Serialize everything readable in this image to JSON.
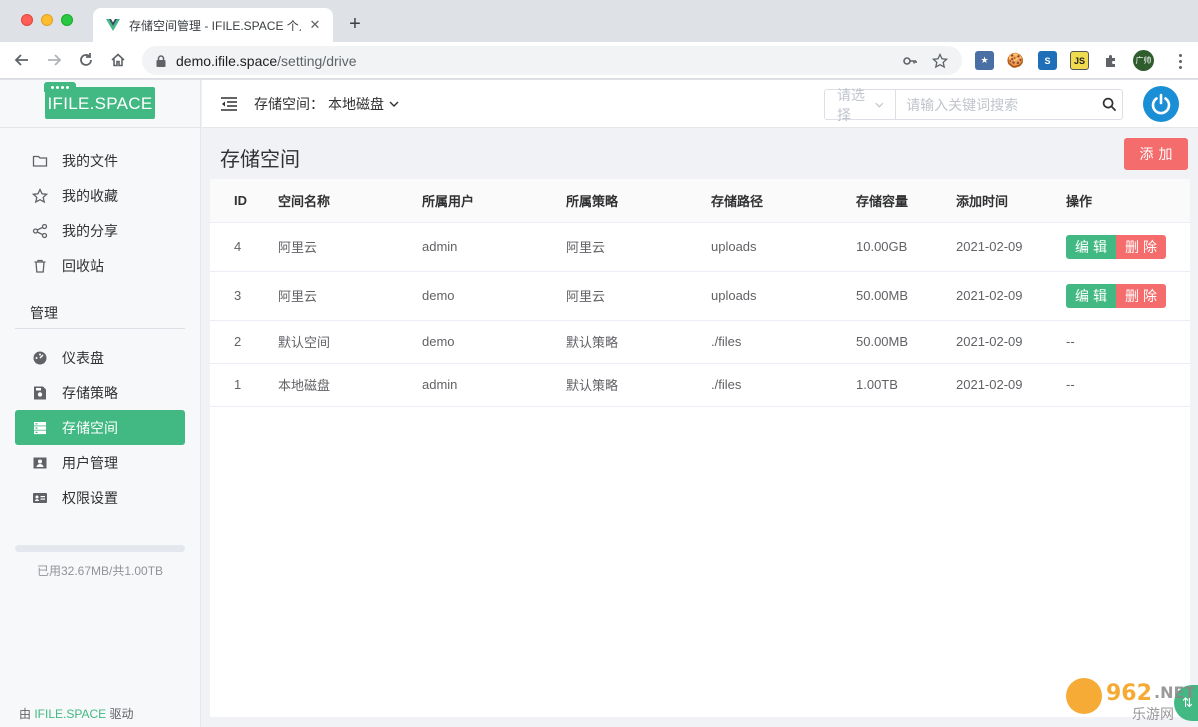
{
  "browser": {
    "tab_title": "存储空间管理 - IFILE.SPACE 个人",
    "url_host": "demo.ifile.space",
    "url_path": "/setting/drive",
    "avatar_text": "广帅",
    "ext_js": "JS"
  },
  "app": {
    "logo": "IFILE.SPACE",
    "menu_main": [
      {
        "label": "我的文件",
        "icon": "folder-icon"
      },
      {
        "label": "我的收藏",
        "icon": "star-icon"
      },
      {
        "label": "我的分享",
        "icon": "share-icon"
      },
      {
        "label": "回收站",
        "icon": "trash-icon"
      }
    ],
    "manage_section": "管理",
    "menu_manage": [
      {
        "label": "仪表盘",
        "icon": "dashboard-icon"
      },
      {
        "label": "存储策略",
        "icon": "disk-icon"
      },
      {
        "label": "存储空间",
        "icon": "server-icon"
      },
      {
        "label": "用户管理",
        "icon": "user-card-icon"
      },
      {
        "label": "权限设置",
        "icon": "id-card-icon"
      }
    ],
    "active_item": "存储空间",
    "usage": {
      "text": "已用32.67MB/共1.00TB",
      "fraction": 0.0
    },
    "powered_prefix": "由 ",
    "powered_brand": "IFILE.SPACE",
    "powered_suffix": " 驱动"
  },
  "topbar": {
    "drive_label": "存储空间：",
    "drive_value": "本地磁盘",
    "search_select_placeholder": "请选择",
    "search_placeholder": "请输入关键词搜索"
  },
  "page": {
    "title": "存储空间",
    "add_button": "添加"
  },
  "table": {
    "headers": [
      "ID",
      "空间名称",
      "所属用户",
      "所属策略",
      "存储路径",
      "存储容量",
      "添加时间",
      "操作"
    ],
    "rows": [
      {
        "id": "4",
        "name": "阿里云",
        "user": "admin",
        "policy": "阿里云",
        "path": "uploads",
        "capacity": "10.00GB",
        "time": "2021-02-09",
        "actions": true
      },
      {
        "id": "3",
        "name": "阿里云",
        "user": "demo",
        "policy": "阿里云",
        "path": "uploads",
        "capacity": "50.00MB",
        "time": "2021-02-09",
        "actions": true
      },
      {
        "id": "2",
        "name": "默认空间",
        "user": "demo",
        "policy": "默认策略",
        "path": "./files",
        "capacity": "50.00MB",
        "time": "2021-02-09",
        "actions": false,
        "op_text": "--"
      },
      {
        "id": "1",
        "name": "本地磁盘",
        "user": "admin",
        "policy": "默认策略",
        "path": "./files",
        "capacity": "1.00TB",
        "time": "2021-02-09",
        "actions": false,
        "op_text": "--"
      }
    ],
    "edit_label": "编辑",
    "delete_label": "删除"
  },
  "float_button": "⇅",
  "colors": {
    "brand": "#42b983",
    "danger": "#f56c6c",
    "power": "#1a8fd6"
  }
}
